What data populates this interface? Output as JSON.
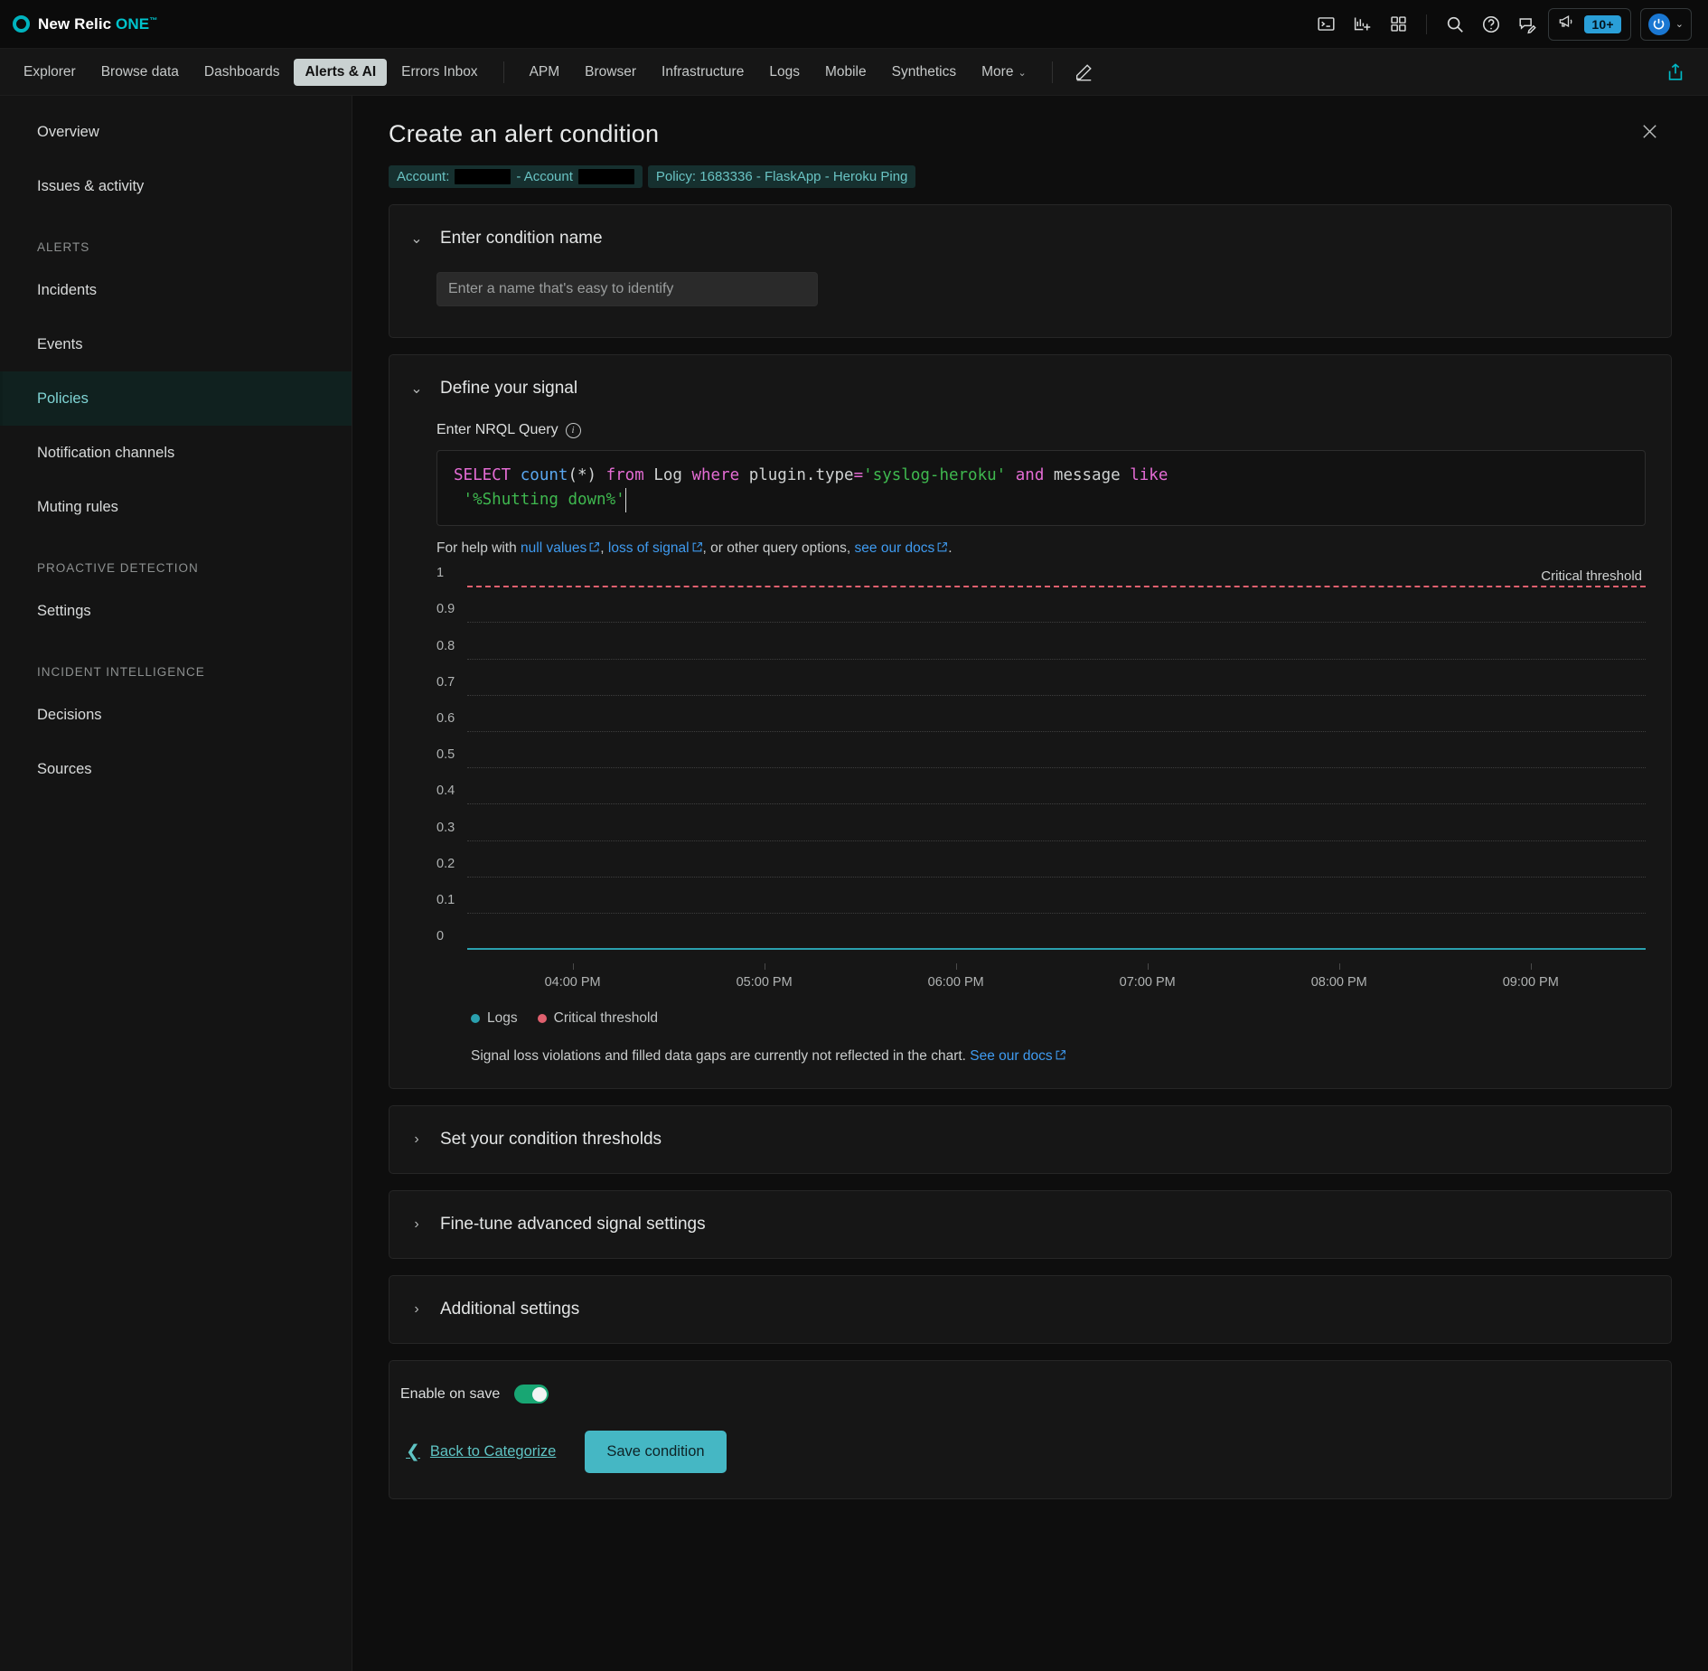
{
  "brand": {
    "name": "New Relic",
    "product": "ONE",
    "tm": "™",
    "logo_icon": "new-relic-logo-icon"
  },
  "topbar": {
    "icons": [
      {
        "name": "terminal-icon",
        "label": "Query terminal"
      },
      {
        "name": "data-explorer-icon",
        "label": "Add data chart"
      },
      {
        "name": "apps-grid-icon",
        "label": "Apps"
      },
      {
        "name": "search-icon",
        "label": "Search"
      },
      {
        "name": "help-circle-icon",
        "label": "Help"
      },
      {
        "name": "feedback-icon",
        "label": "Feedback"
      }
    ],
    "announcements": {
      "icon": "megaphone-icon",
      "badge": "10+"
    },
    "user": {
      "avatar_icon": "user-avatar-icon",
      "caret": "⌄"
    }
  },
  "nav": {
    "primary": [
      {
        "label": "Explorer",
        "active": false
      },
      {
        "label": "Browse data",
        "active": false
      },
      {
        "label": "Dashboards",
        "active": false
      },
      {
        "label": "Alerts & AI",
        "active": true
      },
      {
        "label": "Errors Inbox",
        "active": false
      }
    ],
    "secondary": [
      {
        "label": "APM"
      },
      {
        "label": "Browser"
      },
      {
        "label": "Infrastructure"
      },
      {
        "label": "Logs"
      },
      {
        "label": "Mobile"
      },
      {
        "label": "Synthetics"
      },
      {
        "label": "More",
        "caret": "⌄"
      }
    ],
    "edit_icon": "pencil-icon",
    "share_icon": "share-upload-icon"
  },
  "sidebar": {
    "items": [
      {
        "label": "Overview",
        "active": false,
        "type": "item"
      },
      {
        "label": "Issues & activity",
        "active": false,
        "type": "item"
      },
      {
        "label": "ALERTS",
        "type": "group"
      },
      {
        "label": "Incidents",
        "active": false,
        "type": "item"
      },
      {
        "label": "Events",
        "active": false,
        "type": "item"
      },
      {
        "label": "Policies",
        "active": true,
        "type": "item"
      },
      {
        "label": "Notification channels",
        "active": false,
        "type": "item"
      },
      {
        "label": "Muting rules",
        "active": false,
        "type": "item"
      },
      {
        "label": "PROACTIVE DETECTION",
        "type": "group"
      },
      {
        "label": "Settings",
        "active": false,
        "type": "item"
      },
      {
        "label": "INCIDENT INTELLIGENCE",
        "type": "group"
      },
      {
        "label": "Decisions",
        "active": false,
        "type": "item"
      },
      {
        "label": "Sources",
        "active": false,
        "type": "item"
      }
    ]
  },
  "page": {
    "title": "Create an alert condition",
    "close_icon": "close-icon",
    "breadcrumbs": {
      "account_prefix": "Account:",
      "account_separator": "- Account",
      "account_redacted": true,
      "policy": "Policy: 1683336 - FlaskApp - Heroku Ping"
    }
  },
  "sections": {
    "condition_name": {
      "title": "Enter condition name",
      "expanded": true,
      "chevron": "⌄",
      "input_placeholder": "Enter a name that's easy to identify",
      "input_value": ""
    },
    "define_signal": {
      "title": "Define your signal",
      "expanded": true,
      "chevron": "⌄",
      "query_label": "Enter NRQL Query",
      "info_icon": "info-icon",
      "query_tokens": [
        {
          "t": "SELECT",
          "c": "keyword"
        },
        {
          "t": " ",
          "c": "plain"
        },
        {
          "t": "count",
          "c": "func"
        },
        {
          "t": "(*)",
          "c": "punct"
        },
        {
          "t": " ",
          "c": "plain"
        },
        {
          "t": "from",
          "c": "keyword"
        },
        {
          "t": " ",
          "c": "plain"
        },
        {
          "t": "Log",
          "c": "ident"
        },
        {
          "t": " ",
          "c": "plain"
        },
        {
          "t": "where",
          "c": "keyword"
        },
        {
          "t": " ",
          "c": "plain"
        },
        {
          "t": "plugin.type",
          "c": "ident"
        },
        {
          "t": "=",
          "c": "keyword"
        },
        {
          "t": "'syslog-heroku'",
          "c": "string"
        },
        {
          "t": " ",
          "c": "plain"
        },
        {
          "t": "and",
          "c": "keyword"
        },
        {
          "t": " ",
          "c": "plain"
        },
        {
          "t": "message",
          "c": "ident"
        },
        {
          "t": " ",
          "c": "plain"
        },
        {
          "t": "like",
          "c": "keyword"
        },
        {
          "t": "\n ",
          "c": "plain"
        },
        {
          "t": "'%Shutting down%'",
          "c": "string"
        }
      ],
      "query_text": "SELECT count(*) from Log where plugin.type='syslog-heroku' and message like '%Shutting down%'",
      "help": {
        "prefix": "For help with ",
        "link1": "null values",
        "mid1": ", ",
        "link2": "loss of signal",
        "mid2": ", or other query options, ",
        "link3": "see our docs",
        "suffix": "."
      },
      "footnote": {
        "text": "Signal loss violations and filled data gaps are currently not reflected in the chart.",
        "link": "See our docs"
      }
    },
    "collapsed": [
      {
        "title": "Set your condition thresholds",
        "chevron": "›"
      },
      {
        "title": "Fine-tune advanced signal settings",
        "chevron": "›"
      },
      {
        "title": "Additional settings",
        "chevron": "›"
      }
    ]
  },
  "chart_data": {
    "type": "line",
    "title": "",
    "xlabel": "",
    "ylabel": "",
    "grid": true,
    "legend_position": "bottom-left",
    "ylim": [
      0,
      1
    ],
    "yticks": [
      "1",
      "0.9",
      "0.8",
      "0.7",
      "0.6",
      "0.5",
      "0.4",
      "0.3",
      "0.2",
      "0.1",
      "0"
    ],
    "ytick_values": [
      1,
      0.9,
      0.8,
      0.7,
      0.6,
      0.5,
      0.4,
      0.3,
      0.2,
      0.1,
      0
    ],
    "x": [
      "04:00 PM",
      "05:00 PM",
      "06:00 PM",
      "07:00 PM",
      "08:00 PM",
      "09:00 PM"
    ],
    "xtick_labels": [
      "04:00 PM",
      "05:00 PM",
      "06:00 PM",
      "07:00 PM",
      "08:00 PM",
      "09:00 PM"
    ],
    "series": [
      {
        "name": "Logs",
        "color": "#2aa0ae",
        "values": [
          0,
          0,
          0,
          0,
          0,
          0
        ]
      },
      {
        "name": "Critical threshold",
        "color": "#e0606e",
        "style": "dashed",
        "constant": 1,
        "label": "Critical threshold",
        "values": [
          1,
          1,
          1,
          1,
          1,
          1
        ]
      }
    ],
    "legend": [
      {
        "label": "Logs",
        "color": "#2aa0ae"
      },
      {
        "label": "Critical threshold",
        "color": "#e0606e"
      }
    ],
    "annotations": [
      {
        "text": "Critical threshold",
        "y": 1,
        "position": "top-right"
      }
    ]
  },
  "footer": {
    "enable_label": "Enable on save",
    "enable_on": true,
    "back_label": "Back to Categorize",
    "back_icon": "chevron-left-icon",
    "save_label": "Save condition"
  },
  "colors": {
    "accent": "#00bac7",
    "brand_teal": "#00c3cc",
    "primary_button": "#45b7c4",
    "toggle_on": "#18a673",
    "badge_blue": "#2a9fd8",
    "link_blue": "#3f9bf0",
    "critical": "#e0606e",
    "signal": "#2aa0ae",
    "sidebar_active_text": "#7fd4d4"
  }
}
